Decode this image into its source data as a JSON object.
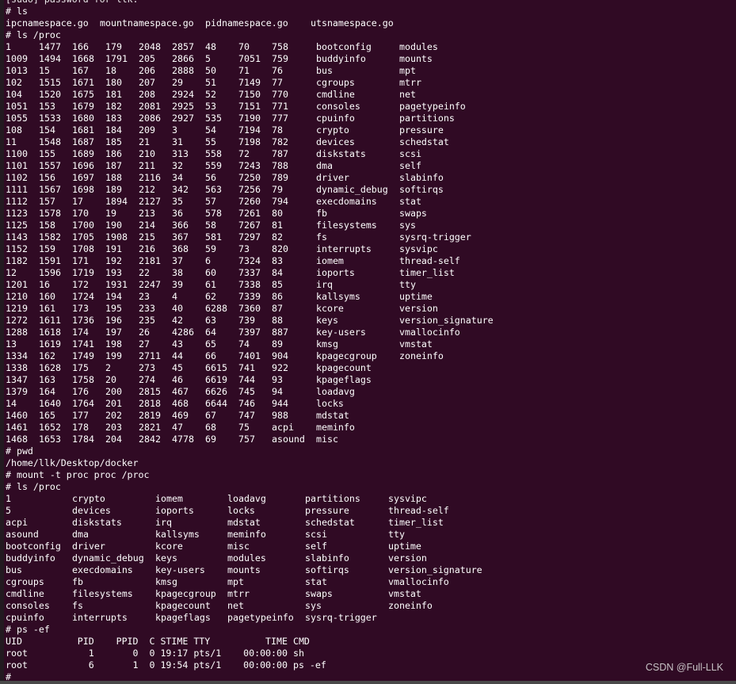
{
  "terminal": {
    "cut_top_line": "[sudo] password for llk:",
    "cmd_ls": "# ls",
    "ls_output": [
      "ipcnamespace.go",
      "mountnamespace.go",
      "pidnamespace.go",
      "utsnamespace.go"
    ],
    "cmd_ls_proc_1": "# ls /proc",
    "proc_before_mount": [
      [
        "1",
        "1477",
        "166",
        "179",
        "2048",
        "2857",
        "48",
        "70",
        "758",
        "bootconfig",
        "modules"
      ],
      [
        "1009",
        "1494",
        "1668",
        "1791",
        "205",
        "2866",
        "5",
        "7051",
        "759",
        "buddyinfo",
        "mounts"
      ],
      [
        "1013",
        "15",
        "167",
        "18",
        "206",
        "2888",
        "50",
        "71",
        "76",
        "bus",
        "mpt"
      ],
      [
        "102",
        "1515",
        "1671",
        "180",
        "207",
        "29",
        "51",
        "7149",
        "77",
        "cgroups",
        "mtrr"
      ],
      [
        "104",
        "1520",
        "1675",
        "181",
        "208",
        "2924",
        "52",
        "7150",
        "770",
        "cmdline",
        "net"
      ],
      [
        "1051",
        "153",
        "1679",
        "182",
        "2081",
        "2925",
        "53",
        "7151",
        "771",
        "consoles",
        "pagetypeinfo"
      ],
      [
        "1055",
        "1533",
        "1680",
        "183",
        "2086",
        "2927",
        "535",
        "7190",
        "777",
        "cpuinfo",
        "partitions"
      ],
      [
        "108",
        "154",
        "1681",
        "184",
        "209",
        "3",
        "54",
        "7194",
        "78",
        "crypto",
        "pressure"
      ],
      [
        "11",
        "1548",
        "1687",
        "185",
        "21",
        "31",
        "55",
        "7198",
        "782",
        "devices",
        "schedstat"
      ],
      [
        "1100",
        "155",
        "1689",
        "186",
        "210",
        "313",
        "558",
        "72",
        "787",
        "diskstats",
        "scsi"
      ],
      [
        "1101",
        "1557",
        "1696",
        "187",
        "211",
        "32",
        "559",
        "7243",
        "788",
        "dma",
        "self"
      ],
      [
        "1102",
        "156",
        "1697",
        "188",
        "2116",
        "34",
        "56",
        "7250",
        "789",
        "driver",
        "slabinfo"
      ],
      [
        "1111",
        "1567",
        "1698",
        "189",
        "212",
        "342",
        "563",
        "7256",
        "79",
        "dynamic_debug",
        "softirqs"
      ],
      [
        "1112",
        "157",
        "17",
        "1894",
        "2127",
        "35",
        "57",
        "7260",
        "794",
        "execdomains",
        "stat"
      ],
      [
        "1123",
        "1578",
        "170",
        "19",
        "213",
        "36",
        "578",
        "7261",
        "80",
        "fb",
        "swaps"
      ],
      [
        "1125",
        "158",
        "1700",
        "190",
        "214",
        "366",
        "58",
        "7267",
        "81",
        "filesystems",
        "sys"
      ],
      [
        "1143",
        "1582",
        "1705",
        "1908",
        "215",
        "367",
        "581",
        "7297",
        "82",
        "fs",
        "sysrq-trigger"
      ],
      [
        "1152",
        "159",
        "1708",
        "191",
        "216",
        "368",
        "59",
        "73",
        "820",
        "interrupts",
        "sysvipc"
      ],
      [
        "1182",
        "1591",
        "171",
        "192",
        "2181",
        "37",
        "6",
        "7324",
        "83",
        "iomem",
        "thread-self"
      ],
      [
        "12",
        "1596",
        "1719",
        "193",
        "22",
        "38",
        "60",
        "7337",
        "84",
        "ioports",
        "timer_list"
      ],
      [
        "1201",
        "16",
        "172",
        "1931",
        "2247",
        "39",
        "61",
        "7338",
        "85",
        "irq",
        "tty"
      ],
      [
        "1210",
        "160",
        "1724",
        "194",
        "23",
        "4",
        "62",
        "7339",
        "86",
        "kallsyms",
        "uptime"
      ],
      [
        "1219",
        "161",
        "173",
        "195",
        "233",
        "40",
        "6288",
        "7360",
        "87",
        "kcore",
        "version"
      ],
      [
        "1272",
        "1611",
        "1736",
        "196",
        "235",
        "42",
        "63",
        "739",
        "88",
        "keys",
        "version_signature"
      ],
      [
        "1288",
        "1618",
        "174",
        "197",
        "26",
        "4286",
        "64",
        "7397",
        "887",
        "key-users",
        "vmallocinfo"
      ],
      [
        "13",
        "1619",
        "1741",
        "198",
        "27",
        "43",
        "65",
        "74",
        "89",
        "kmsg",
        "vmstat"
      ],
      [
        "1334",
        "162",
        "1749",
        "199",
        "2711",
        "44",
        "66",
        "7401",
        "904",
        "kpagecgroup",
        "zoneinfo"
      ],
      [
        "1338",
        "1628",
        "175",
        "2",
        "273",
        "45",
        "6615",
        "741",
        "922",
        "kpagecount",
        ""
      ],
      [
        "1347",
        "163",
        "1758",
        "20",
        "274",
        "46",
        "6619",
        "744",
        "93",
        "kpageflags",
        ""
      ],
      [
        "1379",
        "164",
        "176",
        "200",
        "2815",
        "467",
        "6626",
        "745",
        "94",
        "loadavg",
        ""
      ],
      [
        "14",
        "1640",
        "1764",
        "201",
        "2818",
        "468",
        "6644",
        "746",
        "944",
        "locks",
        ""
      ],
      [
        "1460",
        "165",
        "177",
        "202",
        "2819",
        "469",
        "67",
        "747",
        "988",
        "mdstat",
        ""
      ],
      [
        "1461",
        "1652",
        "178",
        "203",
        "2821",
        "47",
        "68",
        "75",
        "acpi",
        "meminfo",
        ""
      ],
      [
        "1468",
        "1653",
        "1784",
        "204",
        "2842",
        "4778",
        "69",
        "757",
        "asound",
        "misc",
        ""
      ]
    ],
    "cmd_pwd": "# pwd",
    "pwd_output": "/home/llk/Desktop/docker",
    "cmd_mount": "# mount -t proc proc /proc",
    "cmd_ls_proc_2": "# ls /proc",
    "proc_after_mount": [
      [
        "1",
        "crypto",
        "iomem",
        "loadavg",
        "partitions",
        "sysvipc"
      ],
      [
        "5",
        "devices",
        "ioports",
        "locks",
        "pressure",
        "thread-self"
      ],
      [
        "acpi",
        "diskstats",
        "irq",
        "mdstat",
        "schedstat",
        "timer_list"
      ],
      [
        "asound",
        "dma",
        "kallsyms",
        "meminfo",
        "scsi",
        "tty"
      ],
      [
        "bootconfig",
        "driver",
        "kcore",
        "misc",
        "self",
        "uptime"
      ],
      [
        "buddyinfo",
        "dynamic_debug",
        "keys",
        "modules",
        "slabinfo",
        "version"
      ],
      [
        "bus",
        "execdomains",
        "key-users",
        "mounts",
        "softirqs",
        "version_signature"
      ],
      [
        "cgroups",
        "fb",
        "kmsg",
        "mpt",
        "stat",
        "vmallocinfo"
      ],
      [
        "cmdline",
        "filesystems",
        "kpagecgroup",
        "mtrr",
        "swaps",
        "vmstat"
      ],
      [
        "consoles",
        "fs",
        "kpagecount",
        "net",
        "sys",
        "zoneinfo"
      ],
      [
        "cpuinfo",
        "interrupts",
        "kpageflags",
        "pagetypeinfo",
        "sysrq-trigger",
        ""
      ]
    ],
    "cmd_ps": "# ps -ef",
    "ps_header": "UID          PID    PPID  C STIME TTY          TIME CMD",
    "ps_rows": [
      "root           1       0  0 19:17 pts/1    00:00:00 sh",
      "root           6       1  0 19:54 pts/1    00:00:00 ps -ef"
    ],
    "prompt": "#"
  },
  "watermark": "CSDN @Full-LLK",
  "colors": {
    "background": "#300a24",
    "foreground": "#ffffff"
  }
}
